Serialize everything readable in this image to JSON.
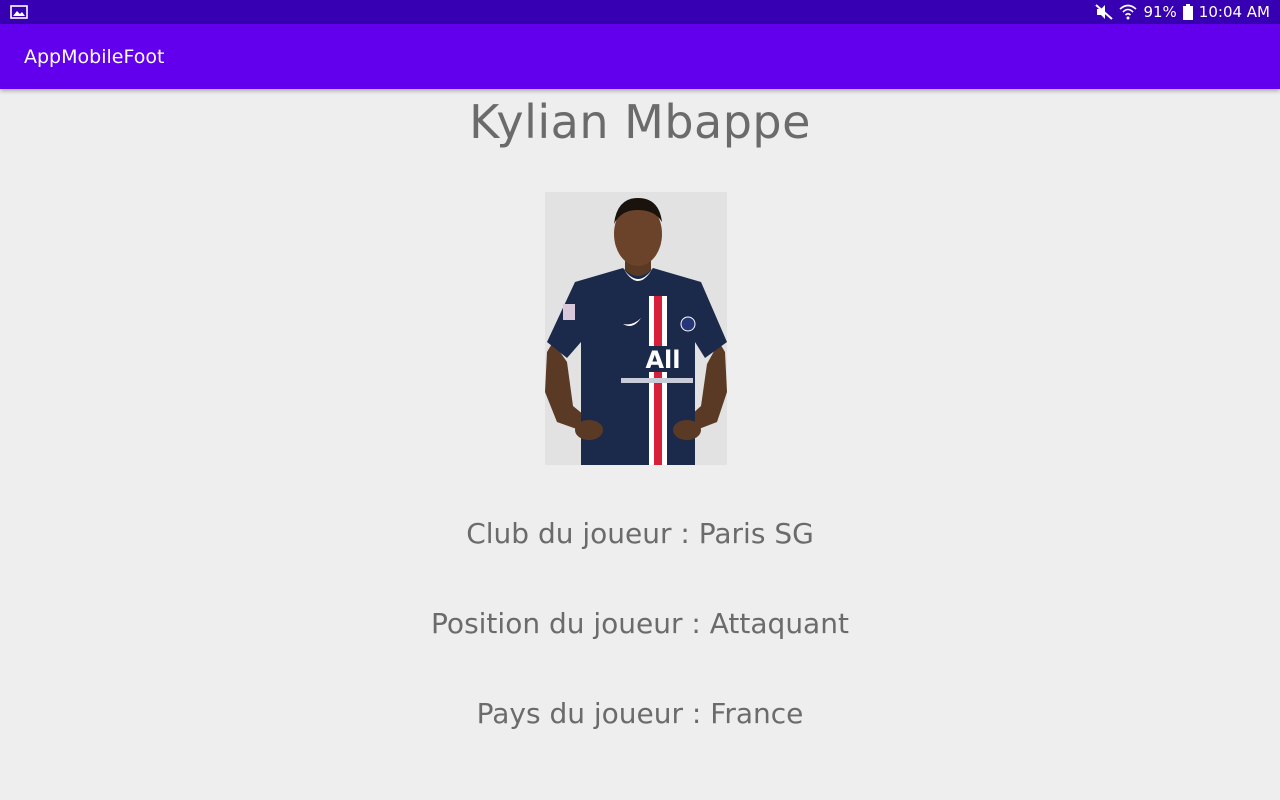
{
  "status_bar": {
    "left_icon": "image-icon",
    "mute_icon": "mute-icon",
    "wifi_icon": "wifi-icon",
    "battery_percent": "91%",
    "battery_icon": "battery-icon",
    "time": "10:04 AM"
  },
  "app_bar": {
    "title": "AppMobileFoot",
    "color": "#6200ee"
  },
  "player": {
    "name": "Kylian Mbappe",
    "photo_icon": "player-photo",
    "club_line": "Club du joueur : Paris SG",
    "position_line": "Position du joueur : Attaquant",
    "country_line": "Pays du joueur : France"
  },
  "colors": {
    "status_bar": "#3700b3",
    "app_bar": "#6200ee",
    "background": "#eeeeee",
    "text": "#6b6b6b"
  }
}
